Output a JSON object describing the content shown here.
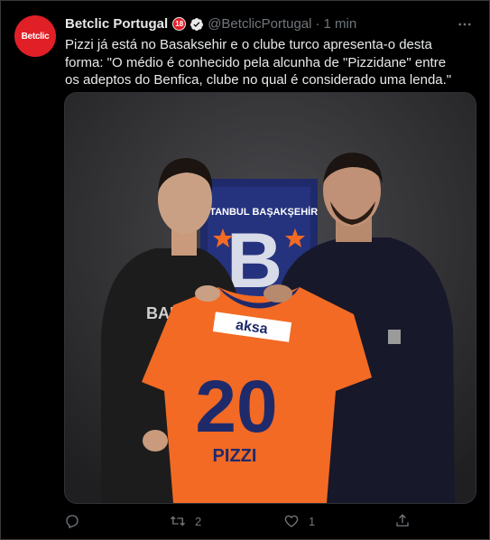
{
  "account": {
    "avatar_text": "Betclic",
    "name": "Betclic Portugal",
    "age_badge": "18",
    "handle": "@BetclicPortugal",
    "separator": "·",
    "time": "1 min"
  },
  "tweet": {
    "text": "Pizzi já está no Basaksehir e o clube turco apresenta-o desta forma: \"O médio é conhecido pela alcunha de \"Pizzidane\" entre os adeptos do Benfica, clube no qual é considerado uma lenda.\""
  },
  "photo": {
    "club_text": "İSTANBUL BAŞAKŞEHİR",
    "sponsor": "aksa",
    "shirt_number": "20",
    "shirt_name": "PIZZI",
    "sweatshirt_text": "BALM",
    "colors": {
      "shirt": "#f26a24",
      "crest": "#1f2a6b",
      "background": "#2b2b2d"
    }
  },
  "actions": {
    "reply_count": "",
    "retweet_count": "2",
    "like_count": "1"
  },
  "icons": [
    "more-icon",
    "verified-icon",
    "reply-icon",
    "retweet-icon",
    "like-icon",
    "share-icon"
  ]
}
